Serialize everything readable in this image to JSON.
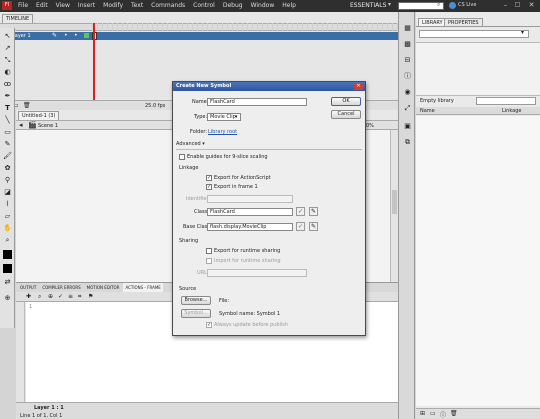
{
  "menubar": {
    "app_icon": "Fl",
    "items": [
      "File",
      "Edit",
      "View",
      "Insert",
      "Modify",
      "Text",
      "Commands",
      "Control",
      "Debug",
      "Window",
      "Help"
    ],
    "workspace": "ESSENTIALS",
    "search_placeholder": "",
    "cs_live": "CS Live"
  },
  "timeline": {
    "tab": "TIMELINE",
    "layer_name": "Layer 1",
    "status": "25.0 fps"
  },
  "document": {
    "tab": "Untitled-1 (3)",
    "scene": "Scene 1",
    "zoom": "0%"
  },
  "library": {
    "tabs": [
      "LIBRARY",
      "PROPERTIES"
    ],
    "empty_label": "Empty library",
    "col_name": "Name",
    "col_linkage": "Linkage"
  },
  "bottom_panels": {
    "tabs": [
      "OUTPUT",
      "COMPILER ERRORS",
      "MOTION EDITOR",
      "ACTIONS - FRAME"
    ],
    "layer_label": "Layer 1 : 1",
    "status": "Line 1 of 1, Col 1"
  },
  "dialog": {
    "title": "Create New Symbol",
    "name_label": "Name:",
    "name_value": "FlashCard",
    "type_label": "Type:",
    "type_value": "Movie Clip",
    "folder_label": "Folder:",
    "folder_value": "Library root",
    "advanced_label": "Advanced",
    "guides_label": "Enable guides for 9-slice scaling",
    "linkage_heading": "Linkage",
    "export_as_label": "Export for ActionScript",
    "export_frame1_label": "Export in frame 1",
    "identifier_label": "Identifier:",
    "class_label": "Class:",
    "class_value": "FlashCard",
    "base_class_label": "Base Class:",
    "base_class_value": "flash.display.MovieClip",
    "sharing_heading": "Sharing",
    "export_runtime_label": "Export for runtime sharing",
    "import_runtime_label": "Import for runtime sharing",
    "url_label": "URL:",
    "source_heading": "Source",
    "browse_label": "Browse...",
    "file_label": "File:",
    "symbol_button": "Symbol...",
    "symbol_name": "Symbol name: Symbol 1",
    "always_update_label": "Always update before publish",
    "ok_label": "OK",
    "cancel_label": "Cancel"
  }
}
